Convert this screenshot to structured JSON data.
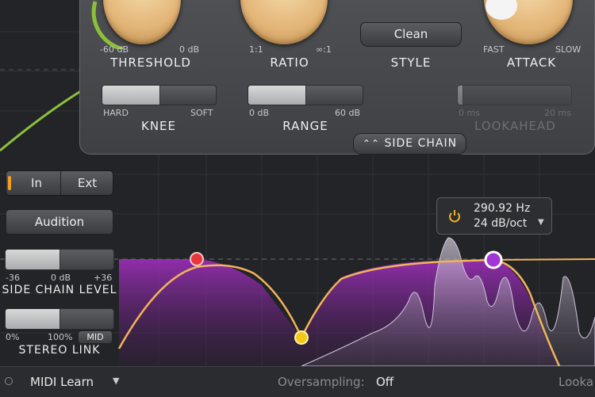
{
  "dynamics": {
    "threshold": {
      "label": "THRESHOLD",
      "min": "-60 dB",
      "max": "0 dB"
    },
    "ratio": {
      "label": "RATIO",
      "min": "1:1",
      "max": "∞:1"
    },
    "style": {
      "label": "STYLE",
      "value": "Clean"
    },
    "attack": {
      "label": "ATTACK",
      "min": "FAST",
      "max": "SLOW"
    },
    "knee": {
      "label": "KNEE",
      "min": "HARD",
      "max": "SOFT",
      "level": 0.5
    },
    "range": {
      "label": "RANGE",
      "min": "0 dB",
      "max": "60 dB",
      "level": 0.5
    },
    "lookahead": {
      "label": "LOOKAHEAD",
      "min": "0 ms",
      "max": "20 ms",
      "level": 0.0
    }
  },
  "side_chain_toggle": "SIDE CHAIN",
  "side_chain": {
    "in_label": "In",
    "ext_label": "Ext",
    "audition_label": "Audition",
    "level": {
      "label": "SIDE CHAIN LEVEL",
      "min": "-36",
      "mid": "0 dB",
      "max": "+36",
      "level": 0.5
    },
    "stereo_link": {
      "label": "STEREO LINK",
      "min": "0%",
      "max": "100%",
      "mid_button": "MID",
      "level": 0.5
    }
  },
  "filter_tooltip": {
    "frequency": "290.92 Hz",
    "slope": "24 dB/oct"
  },
  "bottom_bar": {
    "midi_learn": "MIDI Learn",
    "oversampling_label": "Oversampling:",
    "oversampling_value": "Off",
    "lookahead_cut": "Looka"
  },
  "colors": {
    "accent": "#f0a84a",
    "purple": "#b42fd0",
    "green": "#8cbf3a",
    "knob": "#e3b577"
  }
}
